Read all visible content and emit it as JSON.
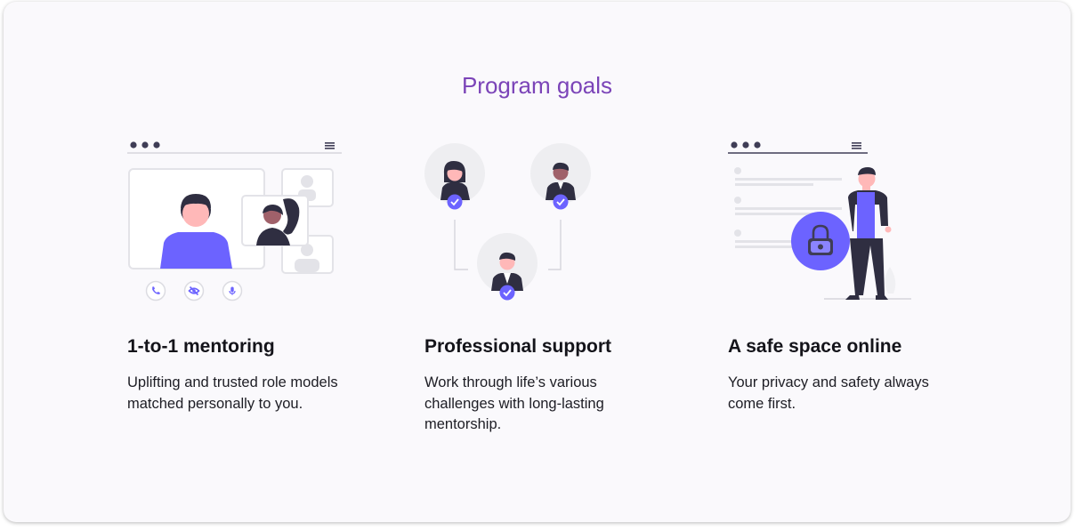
{
  "section": {
    "title": "Program goals"
  },
  "accent_color": "#6c63ff",
  "title_color": "#7b44b8",
  "goals": [
    {
      "heading": "1-to-1 mentoring",
      "description": "Uplifting and trusted role models matched personally to you.",
      "icons": [
        "phone-icon",
        "eye-off-icon",
        "microphone-icon"
      ]
    },
    {
      "heading": "Professional support",
      "description": "Work through life’s various challenges with long-lasting mentorship."
    },
    {
      "heading": "A safe space online",
      "description": "Your privacy and safety always come first."
    }
  ]
}
